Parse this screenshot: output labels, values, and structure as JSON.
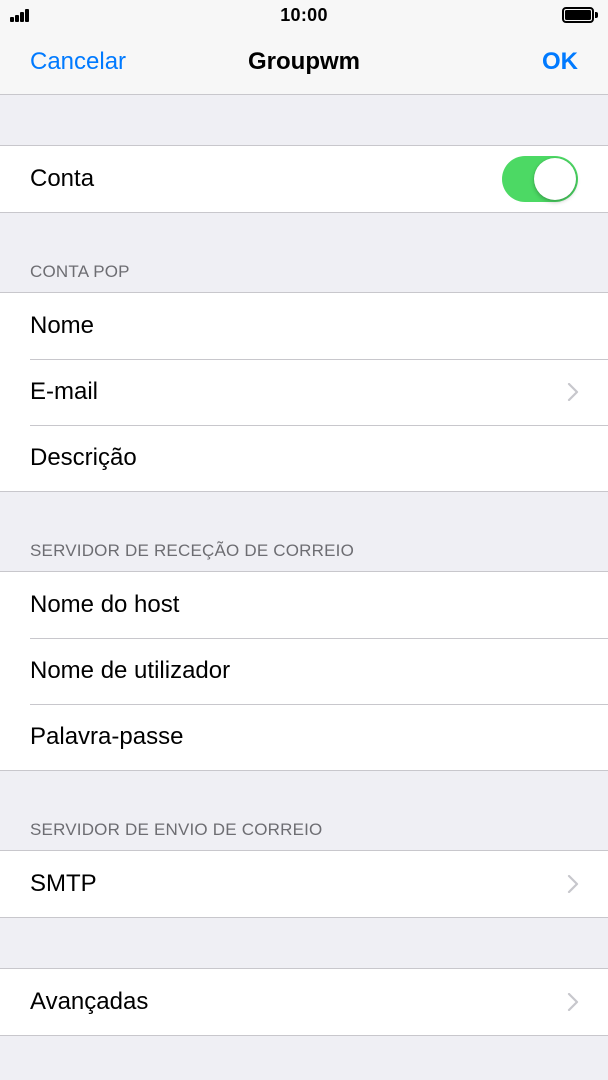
{
  "status_bar": {
    "time": "10:00",
    "signal_icon": "signal-bars-icon",
    "battery_icon": "battery-full-icon"
  },
  "nav": {
    "cancel_label": "Cancelar",
    "title": "Groupwm",
    "ok_label": "OK"
  },
  "account": {
    "label": "Conta",
    "enabled": true,
    "toggle_color": "#4cd964"
  },
  "pop_section": {
    "header": "CONTA POP",
    "rows": [
      {
        "label": "Nome"
      },
      {
        "label": "E-mail"
      },
      {
        "label": "Descrição"
      }
    ]
  },
  "incoming_section": {
    "header": "SERVIDOR DE RECEÇÃO DE CORREIO",
    "rows": [
      {
        "label": "Nome do host"
      },
      {
        "label": "Nome de utilizador"
      },
      {
        "label": "Palavra-passe"
      }
    ]
  },
  "outgoing_section": {
    "header": "SERVIDOR DE ENVIO DE CORREIO",
    "rows": [
      {
        "label": "SMTP"
      }
    ]
  },
  "advanced_section": {
    "rows": [
      {
        "label": "Avançadas"
      }
    ]
  },
  "colors": {
    "accent": "#007aff",
    "background": "#efeff4",
    "separator": "#c8c7cc",
    "section_header": "#6d6d72"
  }
}
